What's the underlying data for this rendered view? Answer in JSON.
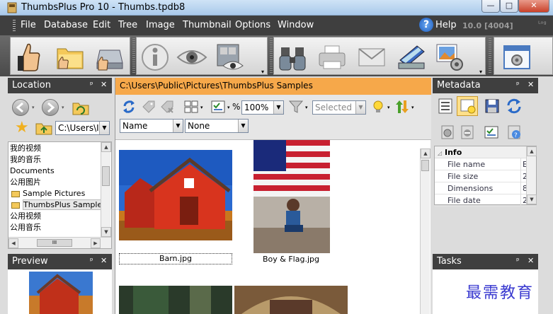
{
  "window": {
    "title": "ThumbsPlus Pro 10 - Thumbs.tpdb8",
    "min": "—",
    "max": "□",
    "close": "✕"
  },
  "menu": {
    "items": [
      "File",
      "Database",
      "Edit",
      "Tree",
      "Image",
      "Thumbnail",
      "Options",
      "Window"
    ],
    "help": "Help",
    "version": "10.0 [4004]",
    "log": "ᴸᵒᵍ"
  },
  "location": {
    "title": "Location",
    "path_combo": "C:\\Users\\I",
    "tree": [
      {
        "label": "我的视频",
        "indent": 0
      },
      {
        "label": "我的音乐",
        "indent": 0
      },
      {
        "label": "Documents",
        "indent": 0
      },
      {
        "label": "公用图片",
        "indent": 0
      },
      {
        "label": "Sample Pictures",
        "indent": 1
      },
      {
        "label": "ThumbsPlus Samples",
        "indent": 1,
        "selected": true
      },
      {
        "label": "公用视频",
        "indent": 0
      },
      {
        "label": "公用音乐",
        "indent": 0
      }
    ],
    "hscroll_grip": "III"
  },
  "preview": {
    "title": "Preview"
  },
  "content": {
    "path": "C:\\Users\\Public\\Pictures\\ThumbsPlus Samples",
    "zoom": "100%",
    "zoom_unit": "%",
    "filter_combo": "Selected",
    "sort1": "Name",
    "sort2": "None",
    "thumbs": [
      {
        "caption": "Barn.jpg"
      },
      {
        "caption": "Boy & Flag.jpg"
      }
    ]
  },
  "metadata": {
    "title": "Metadata",
    "section": "Info",
    "rows": [
      "File name",
      "File size",
      "Dimensions",
      "File date"
    ],
    "row_values": [
      "E",
      "2",
      "8",
      "2"
    ]
  },
  "tasks": {
    "title": "Tasks"
  },
  "watermark": "最需教育",
  "pane_pin": "ᵖ",
  "pane_close": "✕",
  "colors": {
    "accent_orange": "#f6a84a",
    "dark_panel": "#3f3f3f"
  }
}
